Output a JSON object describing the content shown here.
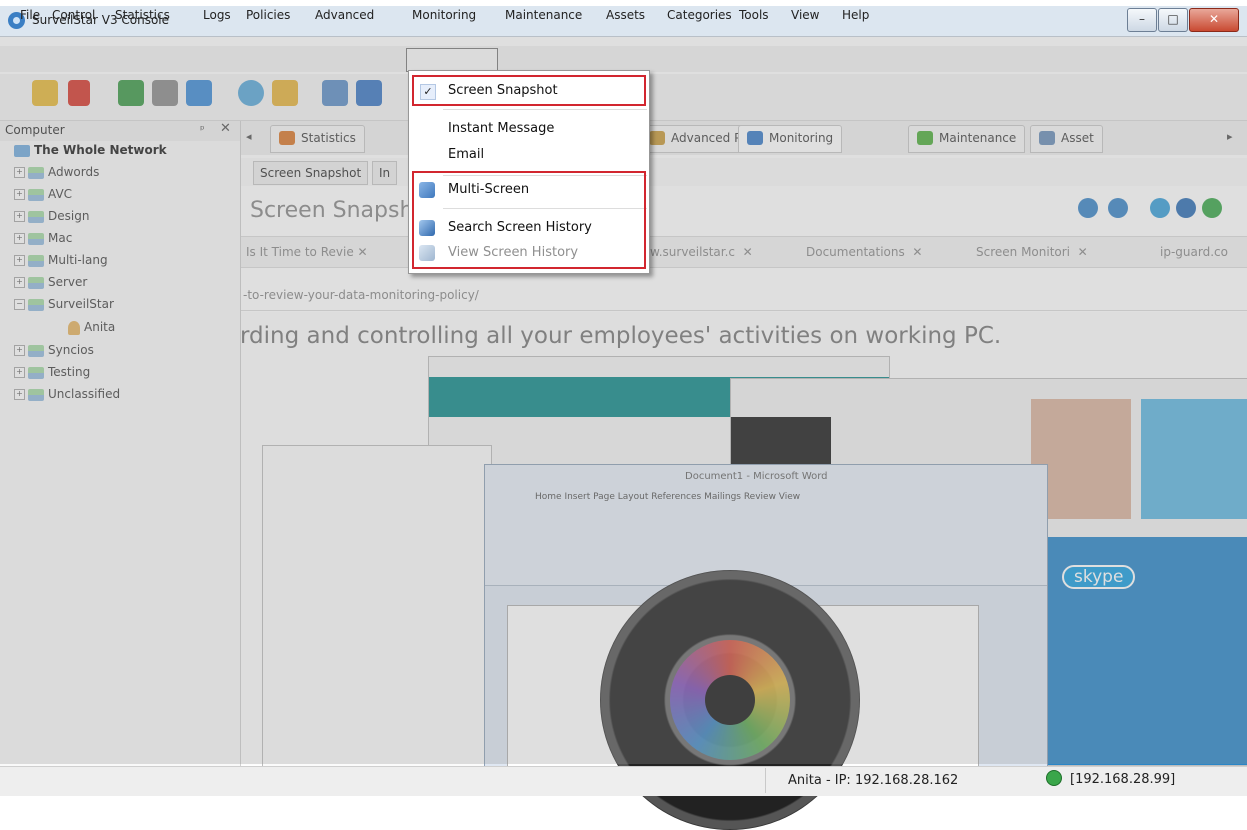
{
  "window": {
    "title": "SurveilStar V3 Console",
    "controls": {
      "minimize": "–",
      "maximize": "□",
      "close": "✕"
    }
  },
  "menubar": {
    "items": [
      "File",
      "Control",
      "Statistics",
      "Logs",
      "Policies",
      "Advanced",
      "Monitoring",
      "Maintenance",
      "Assets",
      "Categories",
      "Tools",
      "View",
      "Help"
    ]
  },
  "monitoring_menu": {
    "items": [
      {
        "label": "Screen Snapshot",
        "checked": true,
        "icon": "check-icon"
      },
      {
        "label": "Instant Message",
        "icon": ""
      },
      {
        "label": "Email",
        "icon": ""
      },
      {
        "label": "Multi-Screen",
        "icon": "multi-screen-icon"
      },
      {
        "label": "Search Screen History",
        "icon": "search-history-icon"
      },
      {
        "label": "View Screen History",
        "icon": "view-history-icon",
        "disabled": true
      }
    ],
    "check_glyph": "✓"
  },
  "left_panel": {
    "title": "Computer",
    "pin": "ᵖ",
    "close": "✕",
    "root": "The Whole Network",
    "groups": [
      "Adwords",
      "AVC",
      "Design",
      "Mac",
      "Multi-lang",
      "Server",
      "SurveilStar",
      "Syncios",
      "Testing",
      "Unclassified"
    ],
    "child": "Anita"
  },
  "main_tabs": {
    "scroll_left": "◂",
    "scroll_right": "▸",
    "items": [
      "Statistics",
      "Advanced Polic",
      "Monitoring",
      "Maintenance",
      "Asset"
    ]
  },
  "subtabs": {
    "items": [
      "Screen Snapshot",
      "In"
    ]
  },
  "page_heading": "Screen Snapsh",
  "browser": {
    "tabs": [
      "Is It Time to Revie",
      "w.surveilstar.c",
      "Documentations",
      "Screen Monitori",
      "ip-guard.co"
    ],
    "close_glyph": "✕",
    "url": "-to-review-your-data-monitoring-policy/",
    "tagline": "rding and controlling all your employees' activities on working PC."
  },
  "collage": {
    "word_title": "Document1 - Microsoft Word",
    "word_tabs": "Home    Insert    Page Layout    References    Mailings    Review    View",
    "skype": "skype"
  },
  "statusbar": {
    "user": "Anita - IP: 192.168.28.162",
    "ip": "[192.168.28.99]"
  },
  "colors": {
    "highlight": "#d2262f",
    "accent": "#3b7fc4",
    "status_ok": "#3aa64a"
  }
}
